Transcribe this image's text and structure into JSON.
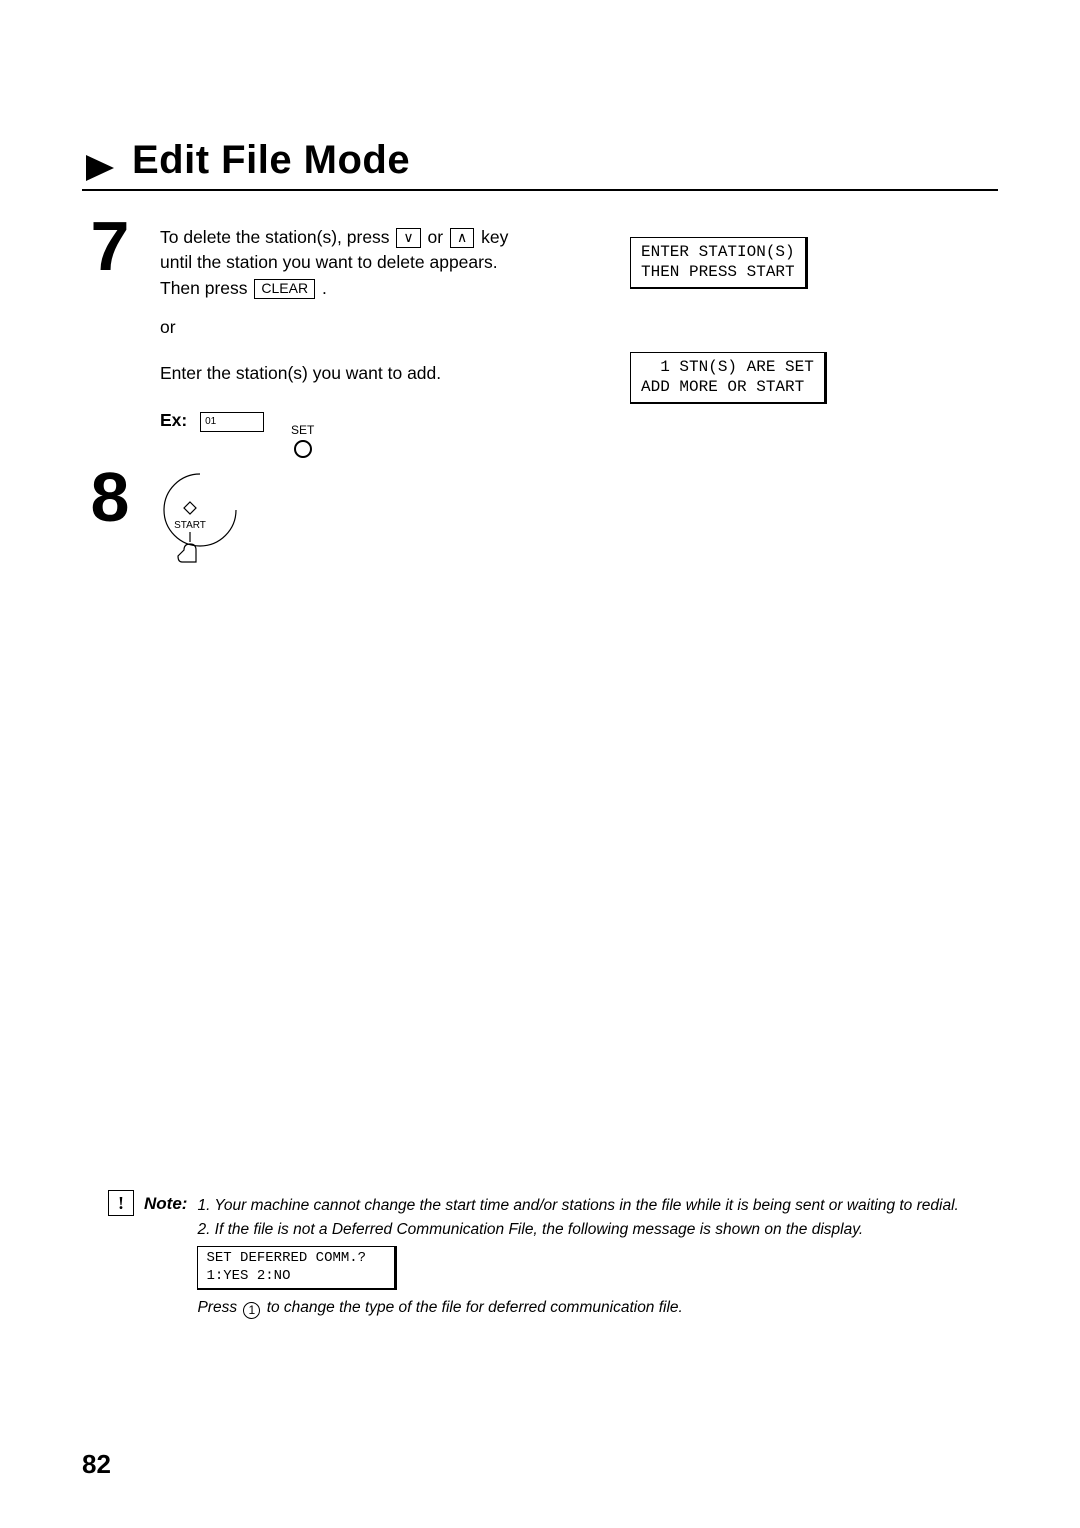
{
  "title": "Edit File Mode",
  "steps": {
    "7": {
      "num": "7",
      "text_a_pre": "To delete the station(s), press ",
      "key_down": "∨",
      "text_a_mid1": " or ",
      "key_up": "∧",
      "text_a_mid2": " key until the station you want to delete appears.  Then press ",
      "key_clear": "CLEAR",
      "text_a_post": ".",
      "or": "or",
      "text_b": "Enter the station(s) you want to add.",
      "ex_label": "Ex:",
      "ex_value": "01",
      "set_label": "SET",
      "lcd1_line1": "ENTER STATION(S)",
      "lcd1_line2": "THEN PRESS START",
      "lcd2_line1": "  1 STN(S) ARE SET",
      "lcd2_line2": "ADD MORE OR START"
    },
    "8": {
      "num": "8",
      "start_label": "START"
    }
  },
  "note": {
    "icon": "!",
    "label": "Note:",
    "n1": "1. Your machine cannot change the start time and/or stations in the file while it is being sent or waiting to redial.",
    "n2": "2. If the file is not a Deferred Communication File, the following message is shown on the display.",
    "lcd_line1": "SET DEFERRED COMM.?",
    "lcd_line2": "1:YES 2:NO",
    "press_pre": "Press ",
    "press_key": "1",
    "press_post": " to change the type of the file for deferred communication file."
  },
  "page_number": "82"
}
